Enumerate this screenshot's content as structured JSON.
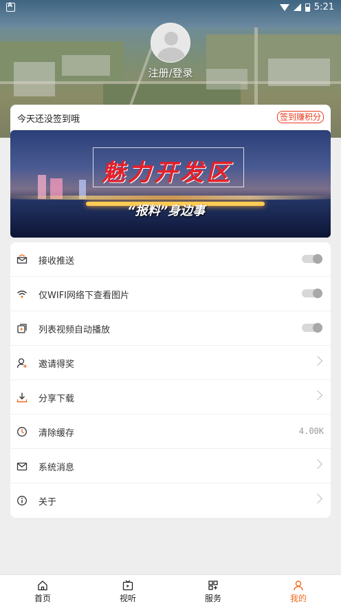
{
  "status_bar": {
    "time": "5:21"
  },
  "profile": {
    "login_label": "注册/登录"
  },
  "signin": {
    "prompt": "今天还没签到哦",
    "badge": "签到赚积分"
  },
  "banner": {
    "title": "魅力开发区",
    "subtitle": "“报料”身边事"
  },
  "menu": [
    {
      "label": "接收推送",
      "icon": "envelope-open-icon",
      "control": "toggle",
      "enabled": false
    },
    {
      "label": "仅WIFI网络下查看图片",
      "icon": "wifi-icon",
      "control": "toggle",
      "enabled": false
    },
    {
      "label": "列表视频自动播放",
      "icon": "video-play-icon",
      "control": "toggle",
      "enabled": false
    },
    {
      "label": "邀请得奖",
      "icon": "user-add-icon",
      "control": "chevron"
    },
    {
      "label": "分享下载",
      "icon": "download-icon",
      "control": "chevron"
    },
    {
      "label": "清除缓存",
      "icon": "clock-clear-icon",
      "control": "value",
      "value": "4.00K"
    },
    {
      "label": "系统消息",
      "icon": "mail-icon",
      "control": "chevron"
    },
    {
      "label": "关于",
      "icon": "info-icon",
      "control": "chevron"
    }
  ],
  "tabs": [
    {
      "label": "首页",
      "icon": "home-icon",
      "active": false
    },
    {
      "label": "视听",
      "icon": "tv-play-icon",
      "active": false
    },
    {
      "label": "服务",
      "icon": "grid-icon",
      "active": false
    },
    {
      "label": "我的",
      "icon": "user-icon",
      "active": true
    }
  ],
  "colors": {
    "accent": "#f06a1e",
    "badge": "#e8391d",
    "background": "#eeeeee"
  }
}
